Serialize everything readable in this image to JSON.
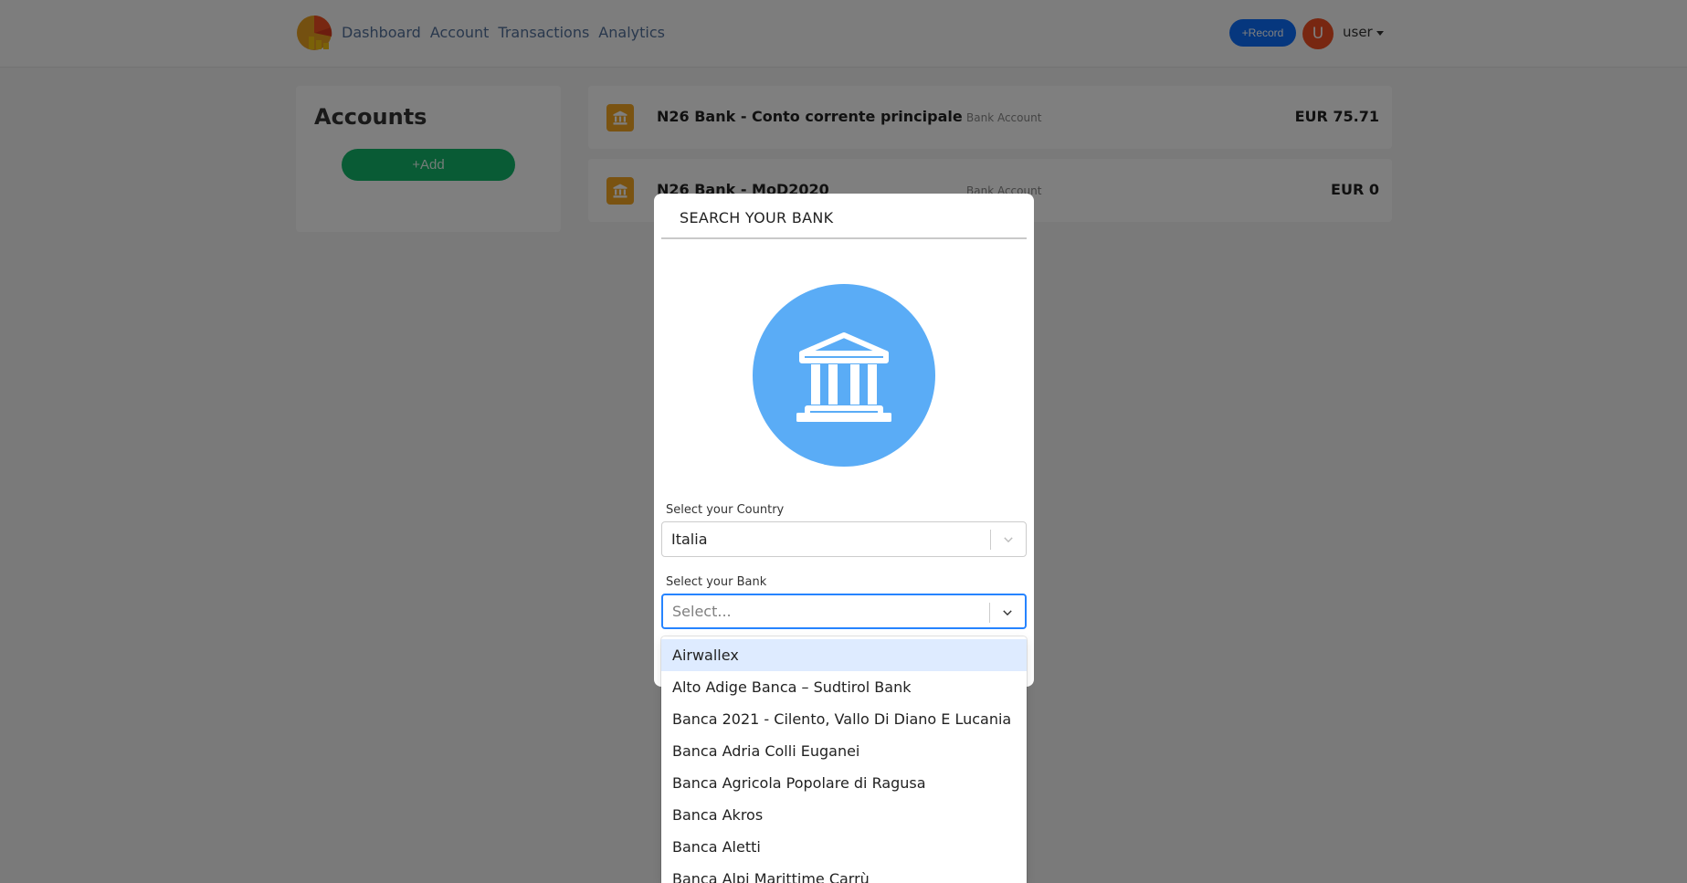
{
  "navbar": {
    "links": [
      "Dashboard",
      "Account",
      "Transactions",
      "Analytics"
    ],
    "record_label": "+Record",
    "avatar_initial": "U",
    "user_label": "user"
  },
  "sidebar": {
    "title": "Accounts",
    "add_label": "+Add"
  },
  "accounts": [
    {
      "name": "N26 Bank - Conto corrente principale",
      "type": "Bank Account",
      "balance": "EUR 75.71"
    },
    {
      "name": "N26 Bank - MoD2020",
      "type": "Bank Account",
      "balance": "EUR 0"
    }
  ],
  "modal": {
    "title": "SEARCH YOUR BANK",
    "country_label": "Select your Country",
    "country_value": "Italia",
    "bank_label": "Select your Bank",
    "bank_placeholder": "Select..."
  },
  "dropdown": {
    "options": [
      "Airwallex",
      "Alto Adige Banca – Sudtirol Bank",
      "Banca 2021 - Cilento, Vallo Di Diano E Lucania",
      "Banca Adria Colli Euganei",
      "Banca Agricola Popolare di Ragusa",
      "Banca Akros",
      "Banca Aletti",
      "Banca Alpi Marittime Carrù"
    ]
  },
  "colors": {
    "accent": "#0d6efd",
    "add_button": "#12b76a",
    "avatar": "#f04f23",
    "bank_circle": "#5aacf6",
    "account_icon": "#f5a623",
    "focus_border": "#2684ff",
    "option_highlight": "#deebff"
  },
  "icons": {
    "logo": "app-logo-icon",
    "bank": "bank-icon",
    "chevron": "chevron-down-icon",
    "caret": "caret-down-icon"
  }
}
